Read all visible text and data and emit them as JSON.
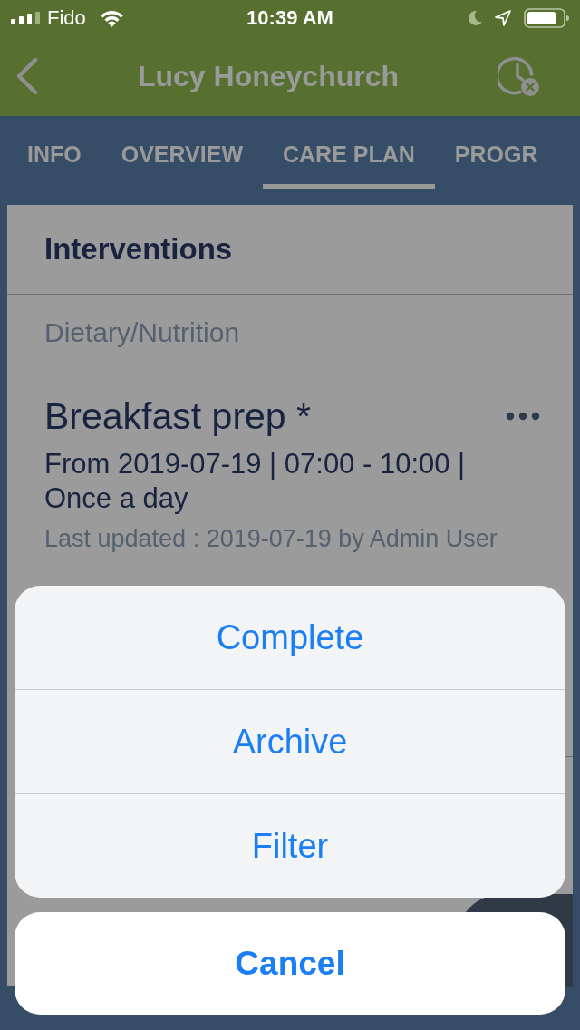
{
  "status_bar": {
    "carrier": "Fido",
    "time": "10:39 AM"
  },
  "nav_bar": {
    "title": "Lucy Honeychurch"
  },
  "tabs": [
    {
      "label": "INFO",
      "selected": false
    },
    {
      "label": "OVERVIEW",
      "selected": false
    },
    {
      "label": "CARE PLAN",
      "selected": true
    },
    {
      "label": "PROGR",
      "selected": false
    }
  ],
  "card": {
    "title": "Interventions",
    "category": "Dietary/Nutrition",
    "items": [
      {
        "title": "Breakfast prep *",
        "schedule": "From 2019-07-19 | 07:00 - 10:00 | Once a day",
        "updated": "Last updated : 2019-07-19 by Admin User"
      }
    ]
  },
  "action_sheet": {
    "actions": [
      "Complete",
      "Archive",
      "Filter"
    ],
    "cancel": "Cancel"
  }
}
